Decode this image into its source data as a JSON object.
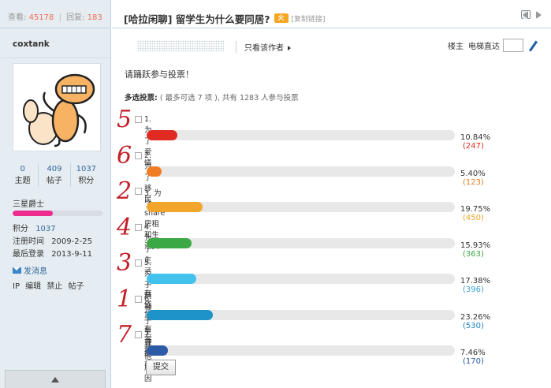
{
  "stats": {
    "views_label": "查看:",
    "views": "45178",
    "replies_label": "回复:",
    "replies": "183",
    "separator": "|"
  },
  "user": {
    "name": "coxtank",
    "counts": [
      {
        "value": "0",
        "label": "主题"
      },
      {
        "value": "409",
        "label": "帖子"
      },
      {
        "value": "1037",
        "label": "积分"
      }
    ],
    "rank": "三星爵士",
    "rank_progress": 0.45,
    "points_label": "积分",
    "points": "1037",
    "registered_label": "注册时间",
    "registered": "2009-2-25",
    "last_login_label": "最后登录",
    "last_login": "2013-9-11",
    "send_message": "发消息",
    "ip_line": [
      "IP",
      "编辑",
      "禁止",
      "帖子"
    ]
  },
  "thread": {
    "title": "[哈拉闲聊] 留学生为什么要同居?",
    "copy_link": "[复制链接]",
    "only_author": "只看该作者",
    "floor_label": "楼主",
    "jump_label": "电梯直达",
    "poll_heading": "请踊跃参与投票！",
    "poll_meta_bold": "多选投票:",
    "poll_meta": "( 最多可选 7 项 ), 共有 1283 人参与投票",
    "submit": "提交"
  },
  "poll": {
    "options": [
      {
        "label": "1. 为了爱情",
        "percent": 10.84,
        "percent_text": "10.84%",
        "count": "(247)",
        "color": "#e02b22",
        "count_color": "#e02b22",
        "handwritten": "5"
      },
      {
        "label": "2. 为了移民",
        "percent": 5.4,
        "percent_text": "5.40%",
        "count": "(123)",
        "color": "#f07d22",
        "count_color": "#f07d22",
        "handwritten": "6"
      },
      {
        "label": "3. 为了share房租和生活费",
        "percent": 19.75,
        "percent_text": "19.75%",
        "count": "(450)",
        "color": "#f2a52b",
        "count_color": "#f2a52b",
        "handwritten": "2"
      },
      {
        "label": "4. 为了生活上有依靠",
        "percent": 15.93,
        "percent_text": "15.93%",
        "count": "(363)",
        "color": "#3ba846",
        "count_color": "#3ba846",
        "handwritten": "4"
      },
      {
        "label": "5. 为了精神上有寄托",
        "percent": 17.38,
        "percent_text": "17.38%",
        "count": "(396)",
        "color": "#44c2ee",
        "count_color": "#3aa0d8",
        "handwritten": "3"
      },
      {
        "label": "6. 为了生理需要",
        "percent": 23.26,
        "percent_text": "23.26%",
        "count": "(530)",
        "color": "#1d93c9",
        "count_color": "#1d7fc0",
        "handwritten": "1"
      },
      {
        "label": "7. 其他原因",
        "percent": 7.46,
        "percent_text": "7.46%",
        "count": "(170)",
        "color": "#2d5ba5",
        "count_color": "#2d5ba5",
        "handwritten": "7"
      }
    ]
  },
  "icons": {
    "hot": "hot-icon",
    "print": "print-icon",
    "prev": "prev-icon",
    "next": "next-icon",
    "mail": "mail-icon",
    "wrench": "wrench-icon",
    "scroll_top": "scroll-top-icon"
  },
  "hot_badge": "火"
}
